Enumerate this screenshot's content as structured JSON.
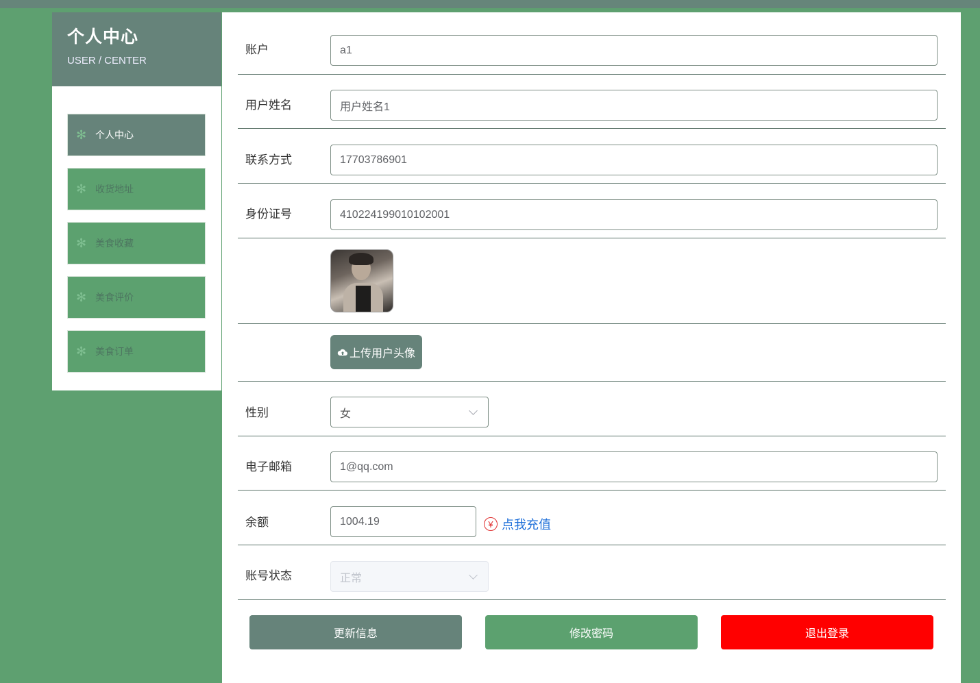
{
  "colors": {
    "accent_dark": "#66837a",
    "accent_green": "#5ca16f",
    "danger": "#ff0000",
    "link": "#1e6fd9"
  },
  "sidebar": {
    "title": "个人中心",
    "subtitle": "USER / CENTER",
    "items": [
      {
        "label": "个人中心",
        "icon": "snowflake-icon",
        "active": true
      },
      {
        "label": "收货地址",
        "icon": "snowflake-icon",
        "active": false
      },
      {
        "label": "美食收藏",
        "icon": "snowflake-icon",
        "active": false
      },
      {
        "label": "美食评价",
        "icon": "snowflake-icon",
        "active": false
      },
      {
        "label": "美食订单",
        "icon": "snowflake-icon",
        "active": false
      }
    ]
  },
  "form": {
    "account": {
      "label": "账户",
      "value": "a1"
    },
    "username": {
      "label": "用户姓名",
      "value": "用户姓名1"
    },
    "phone": {
      "label": "联系方式",
      "value": "17703786901"
    },
    "id_number": {
      "label": "身份证号",
      "value": "410224199010102001"
    },
    "upload_label": "上传用户头像",
    "gender": {
      "label": "性别",
      "value": "女"
    },
    "email": {
      "label": "电子邮箱",
      "value": "1@qq.com"
    },
    "balance": {
      "label": "余额",
      "value": "1004.19",
      "recharge_label": "点我充值",
      "recharge_icon": "yen-icon"
    },
    "status": {
      "label": "账号状态",
      "value": "正常"
    }
  },
  "actions": {
    "update_label": "更新信息",
    "password_label": "修改密码",
    "logout_label": "退出登录"
  }
}
